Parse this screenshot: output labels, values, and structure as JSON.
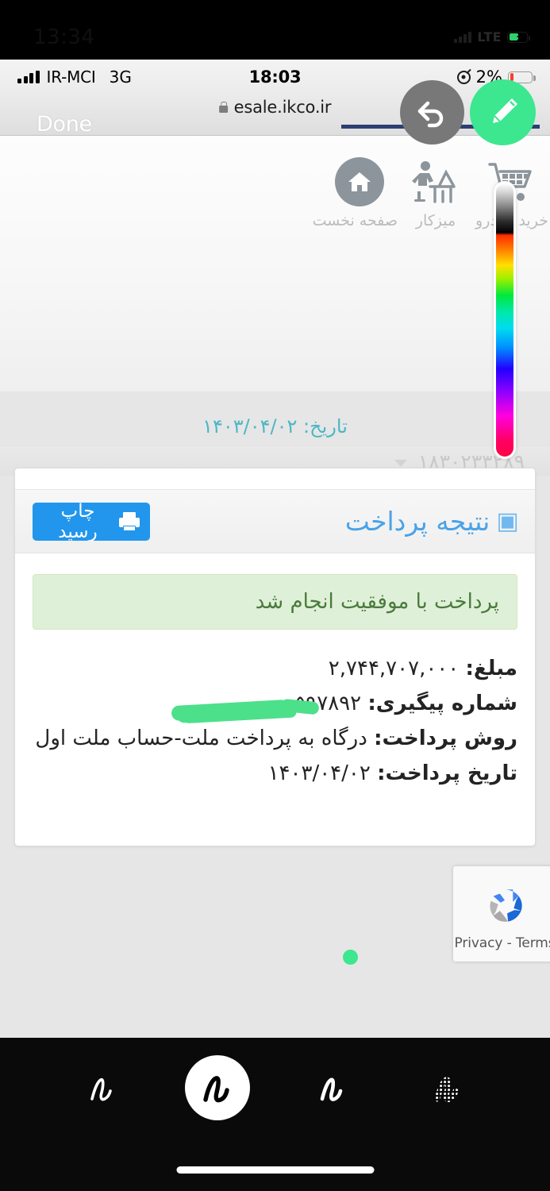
{
  "outer_status": {
    "time": "13:34",
    "network": "LTE",
    "signal_icon": "signal-bars-icon",
    "battery_icon": "battery-charging-icon"
  },
  "safari": {
    "status": {
      "carrier": "IR-MCI",
      "network_type": "3G",
      "time": "18:03",
      "location_icon": "location-arrow-icon",
      "battery_percent": "2%",
      "battery_icon": "battery-low-icon"
    },
    "done_label": "Done",
    "url": "esale.ikco.ir",
    "lock_icon": "lock-icon"
  },
  "site": {
    "nav": [
      {
        "label": "خرید خودرو",
        "icon": "shopping-cart-icon"
      },
      {
        "label": "میزکار",
        "icon": "desk-person-icon"
      },
      {
        "label": "صفحه نخست",
        "icon": "home-icon"
      }
    ],
    "date_line": "تاریخ: ۱۴۰۳/۰۴/۰۲",
    "order_number": "۱۸۳۰۲۳۳۲۸۹",
    "card": {
      "title": "نتیجه پرداخت",
      "print_button": "چاپ رسید",
      "printer_icon": "printer-icon",
      "alert": "پرداخت با موفقیت انجام شد",
      "rows": [
        {
          "label": "مبلغ:",
          "value": "۲,۷۴۴,۷۰۷,۰۰۰"
        },
        {
          "label": "شماره پیگیری:",
          "value": "۵۹۷۸۹۲"
        },
        {
          "label": "روش پرداخت:",
          "value": "درگاه به پرداخت ملت-حساب ملت اول"
        },
        {
          "label": "تاریخ پرداخت:",
          "value": "۱۴۰۳/۰۴/۰۲"
        }
      ]
    },
    "recaptcha": {
      "text": "Privacy - Terms",
      "icon": "recaptcha-logo-icon"
    }
  },
  "markup": {
    "undo_icon": "undo-arrow-icon",
    "pencil_icon": "pencil-icon",
    "color_slider": "color-spectrum-slider",
    "selected_color": "#3ce78f",
    "tools": [
      {
        "name": "pen-tool",
        "selected": false
      },
      {
        "name": "marker-tool",
        "selected": true
      },
      {
        "name": "pencil-tool",
        "selected": false
      },
      {
        "name": "highlighter-tool",
        "selected": false
      }
    ],
    "annotations": [
      {
        "name": "redaction-stroke",
        "color": "#4ce08a"
      },
      {
        "name": "dot-mark",
        "color": "#3ce78f"
      }
    ]
  },
  "colors": {
    "accent_blue": "#2196ec",
    "teal": "#4bb7c4",
    "success_bg": "#dff0d8",
    "success_text": "#4a7a3c",
    "marker_green": "#3ce78f"
  }
}
